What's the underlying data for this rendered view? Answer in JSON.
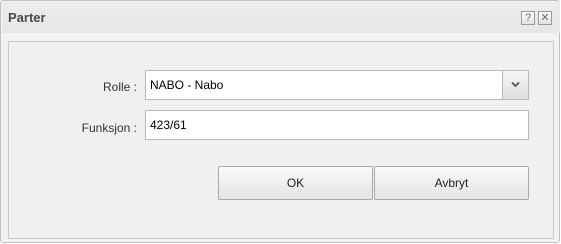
{
  "dialog": {
    "title": "Parter",
    "help_label": "?",
    "close_label": "✕"
  },
  "form": {
    "rolle_label": "Rolle :",
    "rolle_value": "NABO - Nabo",
    "funksjon_label": "Funksjon :",
    "funksjon_value": "423/61"
  },
  "buttons": {
    "ok_label": "OK",
    "cancel_label": "Avbryt"
  },
  "icons": {
    "help": "help-icon",
    "close": "close-icon",
    "dropdown": "chevron-down-icon"
  }
}
